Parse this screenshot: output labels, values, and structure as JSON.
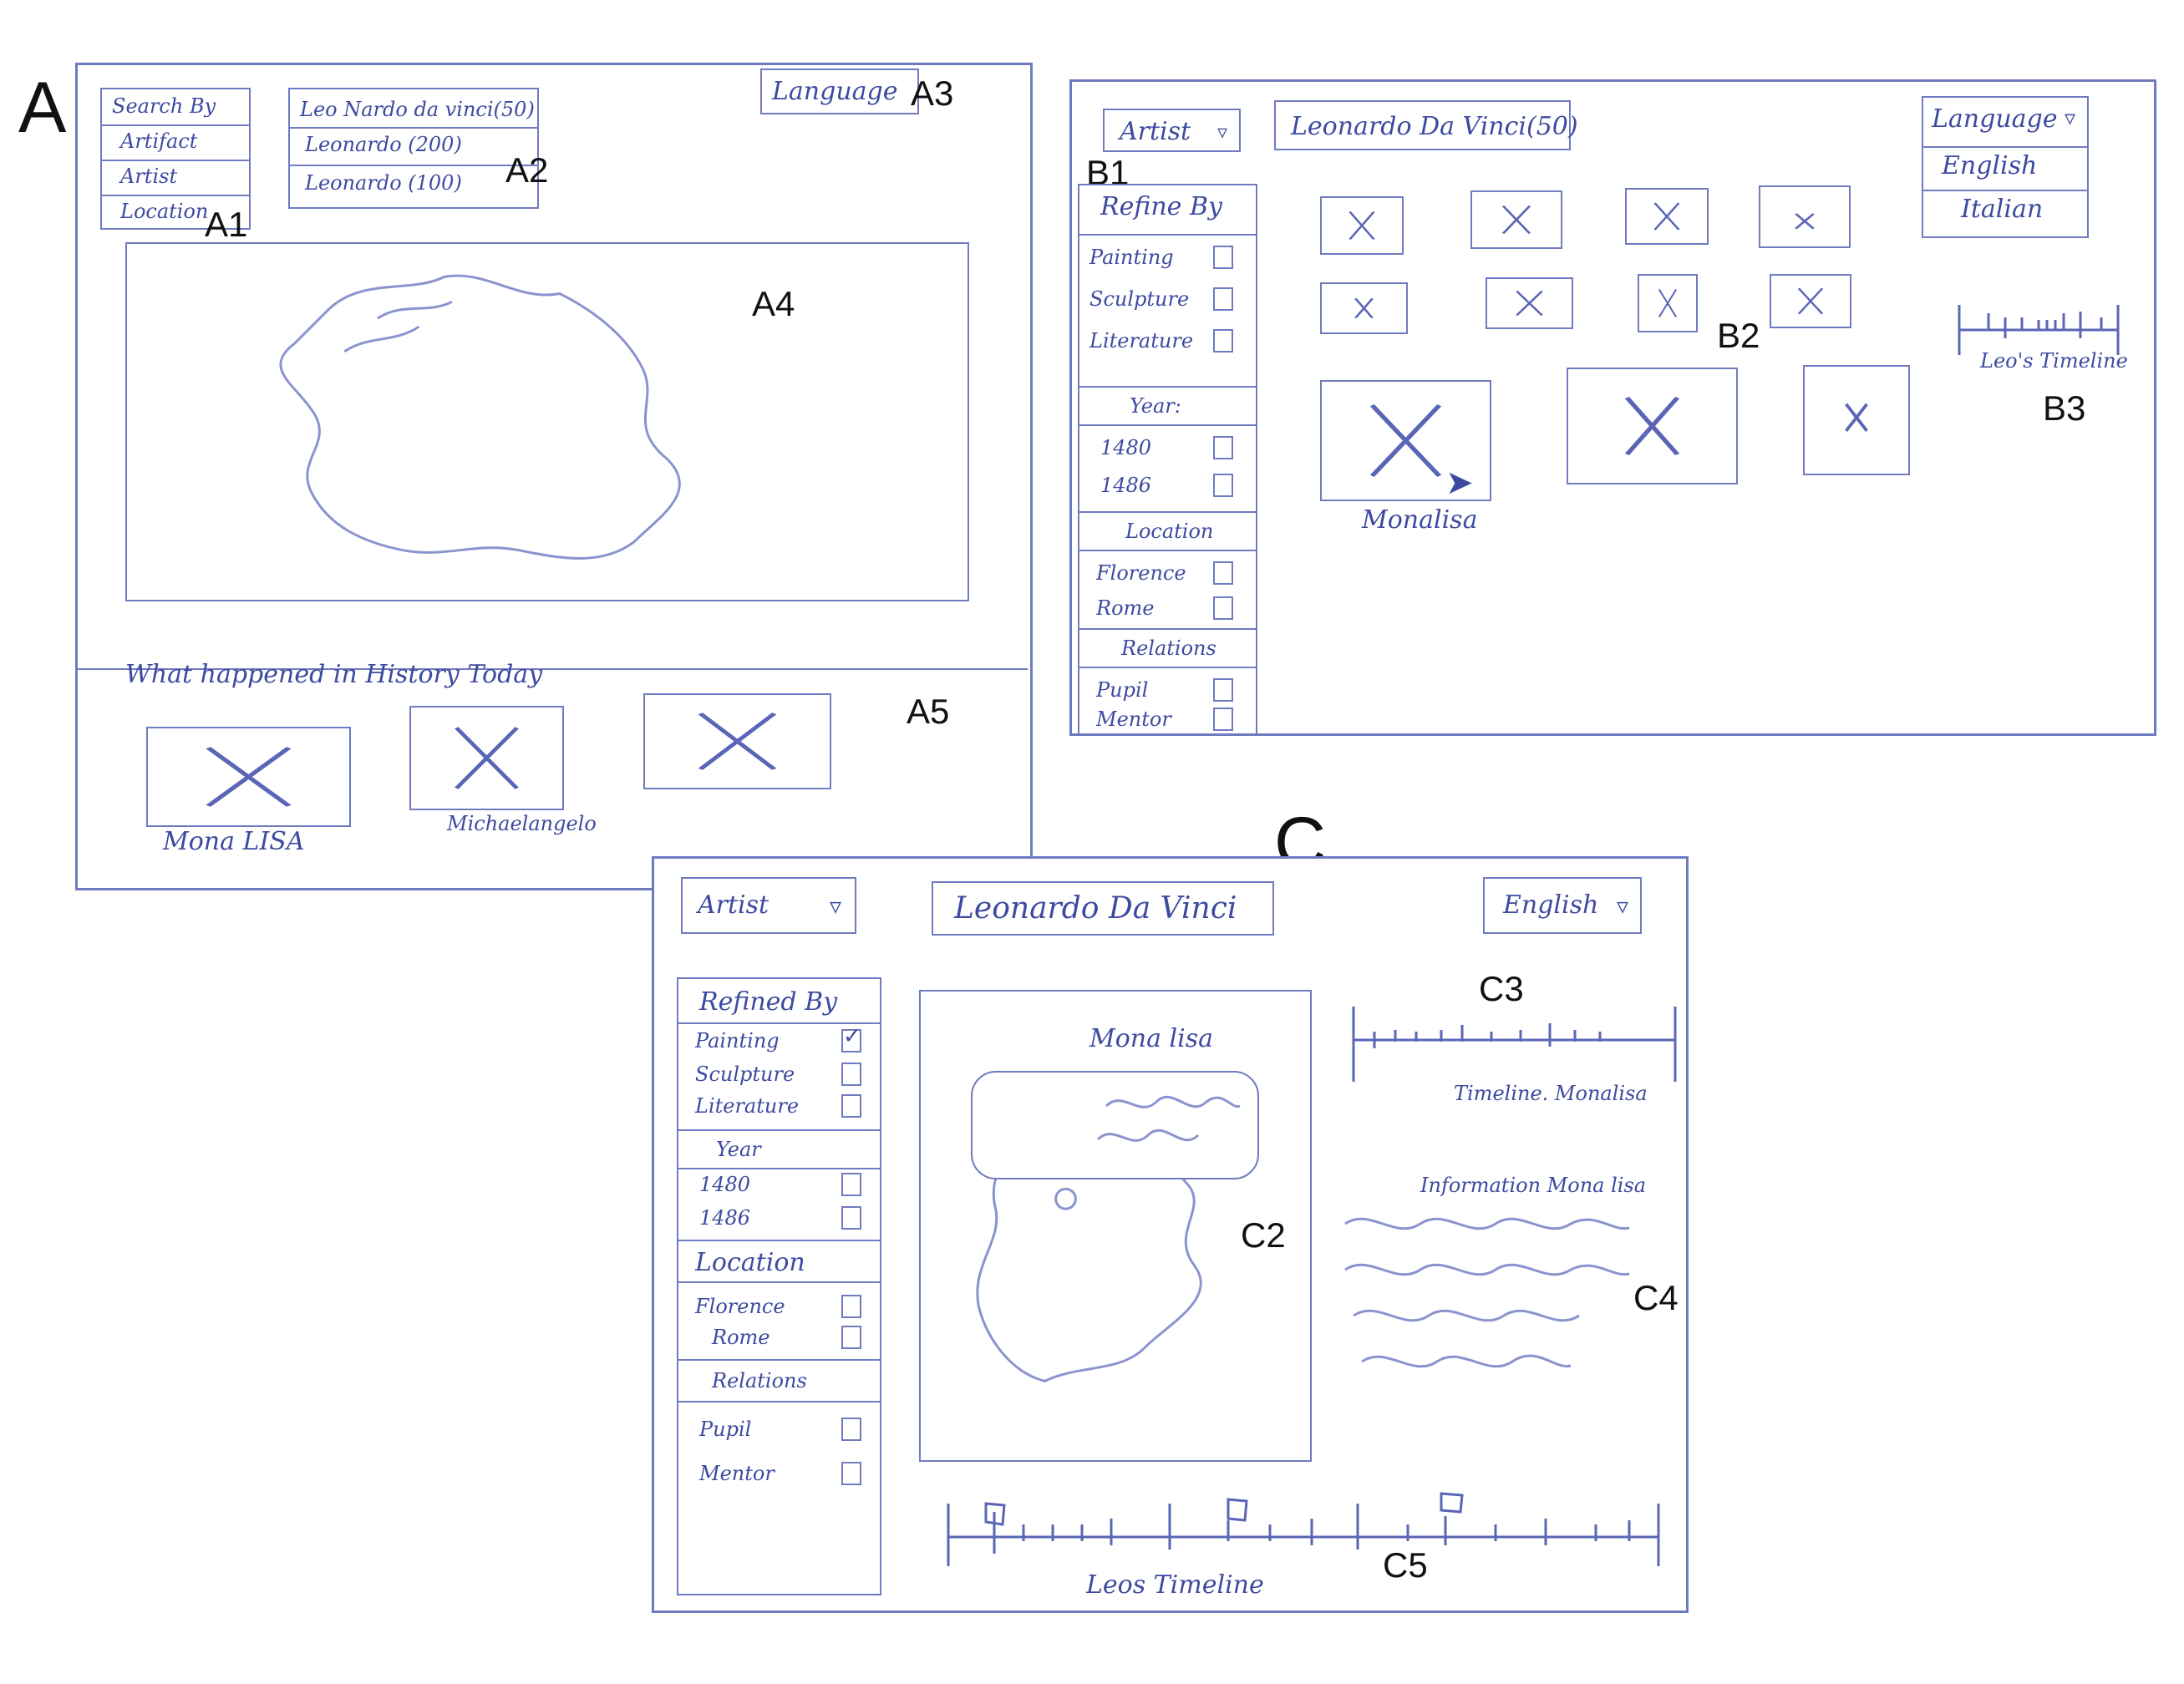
{
  "labels": {
    "a": "A",
    "b": "B",
    "c": "C"
  },
  "callouts": {
    "a1": "A1",
    "a2": "A2",
    "a3": "A3",
    "a4": "A4",
    "a5": "A5",
    "b1": "B1",
    "b2": "B2",
    "b3": "B3",
    "c2": "C2",
    "c3": "C3",
    "c4": "C4",
    "c5": "C5"
  },
  "sketch_a": {
    "search_by": {
      "header": "Search By",
      "options": [
        "Artifact",
        "Artist",
        "Location"
      ]
    },
    "suggestions": [
      "Leo Nardo da vinci(50)",
      "Leonardo (200)",
      "Leonardo (100)"
    ],
    "language": "Language",
    "history_heading": "What happened in History Today",
    "history_items": [
      "Mona LISA",
      "Michaelangelo",
      ""
    ]
  },
  "sketch_b": {
    "search_type": "Artist",
    "search_value": "Leonardo Da Vinci(50)",
    "language": {
      "label": "Language",
      "options": [
        "English",
        "Italian"
      ]
    },
    "filter": {
      "header": "Refine By",
      "sections": [
        {
          "title": "",
          "items": [
            "Painting",
            "Sculpture",
            "Literature"
          ]
        },
        {
          "title": "Year:",
          "items": [
            "1480",
            "1486"
          ]
        },
        {
          "title": "Location",
          "items": [
            "Florence",
            "Rome"
          ]
        },
        {
          "title": "Relations",
          "items": [
            "Pupil",
            "Mentor"
          ]
        }
      ]
    },
    "featured_caption": "Monalisa",
    "timeline_label": "Leo's Timeline"
  },
  "sketch_c": {
    "search_type": "Artist",
    "search_value": "Leonardo Da Vinci",
    "language": "English",
    "filter": {
      "header": "Refined By",
      "sections": [
        {
          "title": "",
          "items": [
            "Painting",
            "Sculpture",
            "Literature"
          ],
          "checked": [
            true,
            false,
            false
          ]
        },
        {
          "title": "Year",
          "items": [
            "1480",
            "1486"
          ],
          "checked": [
            false,
            false
          ]
        },
        {
          "title": "Location",
          "items": [
            "Florence",
            "Rome"
          ],
          "checked": [
            false,
            false
          ]
        },
        {
          "title": "Relations",
          "items": [
            "Pupil",
            "Mentor"
          ],
          "checked": [
            false,
            false
          ]
        }
      ]
    },
    "artwork_title": "Mona lisa",
    "timeline_label": "Timeline. Monalisa",
    "info_heading": "Information Mona lisa",
    "bottom_timeline_label": "Leos Timeline"
  }
}
